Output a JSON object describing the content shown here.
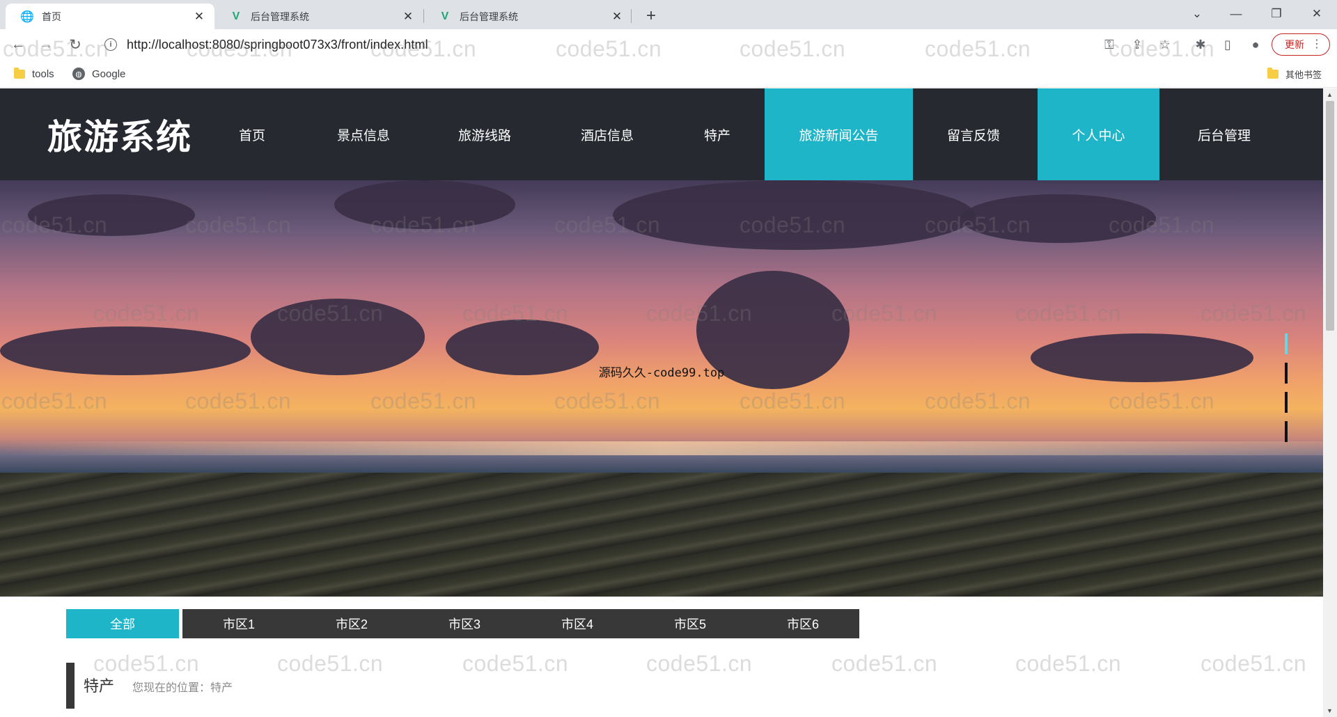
{
  "browser": {
    "tabs": [
      {
        "title": "首页",
        "active": true
      },
      {
        "title": "后台管理系统",
        "active": false
      },
      {
        "title": "后台管理系统",
        "active": false
      }
    ],
    "url": "http://localhost:8080/springboot073x3/front/index.html",
    "update_label": "更新",
    "bookmarks": [
      {
        "label": "tools"
      },
      {
        "label": "Google"
      }
    ],
    "other_bookmarks": "其他书签"
  },
  "site": {
    "logo": "旅游系统",
    "nav": [
      {
        "label": "首页",
        "active": false
      },
      {
        "label": "景点信息",
        "active": false
      },
      {
        "label": "旅游线路",
        "active": false
      },
      {
        "label": "酒店信息",
        "active": false
      },
      {
        "label": "特产",
        "active": false
      },
      {
        "label": "旅游新闻公告",
        "active": true
      },
      {
        "label": "留言反馈",
        "active": false
      },
      {
        "label": "个人中心",
        "active": true
      },
      {
        "label": "后台管理",
        "active": false
      }
    ],
    "banner_caption": "源码久久-code99.top",
    "filters": [
      "全部",
      "市区1",
      "市区2",
      "市区3",
      "市区4",
      "市区5",
      "市区6"
    ],
    "breadcrumb": {
      "title": "特产",
      "location": "您现在的位置：特产"
    },
    "accent_color": "#1fb5c9",
    "header_color": "#262a30"
  },
  "watermark": "code51.cn"
}
